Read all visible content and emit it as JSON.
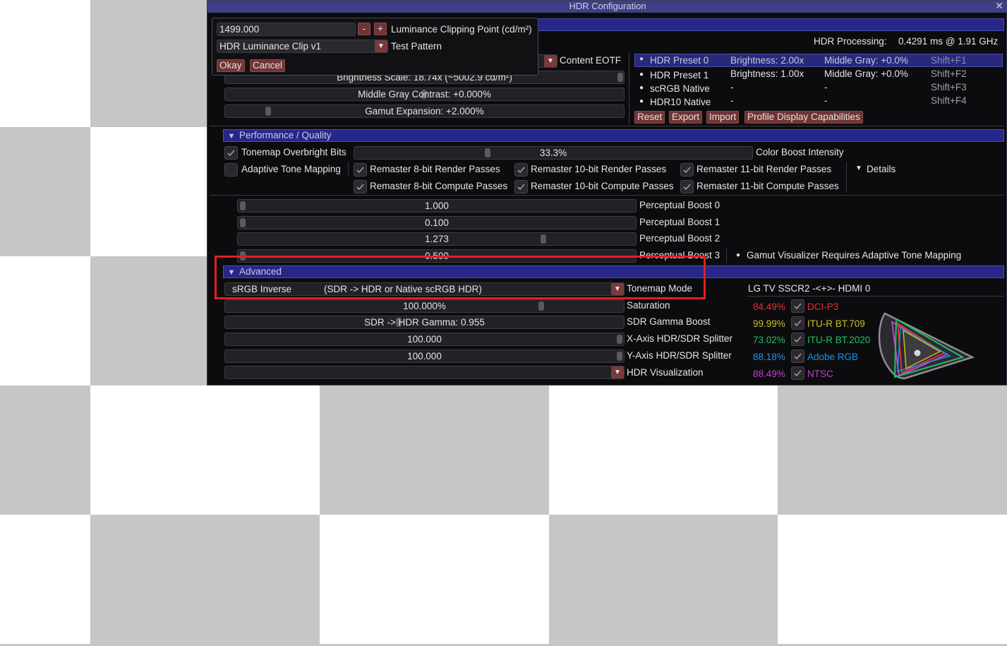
{
  "window": {
    "title": "HDR Configuration"
  },
  "popup": {
    "value": "1499.000",
    "minus": "-",
    "plus": "+",
    "clip_label": "Luminance Clipping Point (cd/m²)",
    "pattern_value": "HDR Luminance Clip v1",
    "pattern_label": "Test Pattern",
    "okay": "Okay",
    "cancel": "Cancel"
  },
  "status": {
    "processing_label": "HDR Processing:",
    "processing_value": "0.4291 ms @ 1.91 GHz"
  },
  "top": {
    "content_eotf_label": "Content EOTF",
    "brightness_scale": "Brightness Scale: 18.74x  (~5002.9 cd/m²)",
    "middle_gray_contrast": "Middle Gray Contrast: +0.000%",
    "gamut_expansion": "Gamut Expansion: +2.000%"
  },
  "presets": [
    {
      "name": "HDR Preset 0",
      "brightness": "Brightness: 2.00x",
      "middle_gray": "Middle Gray:  +0.0%",
      "hotkey": "Shift+F1",
      "selected": true
    },
    {
      "name": "HDR Preset 1",
      "brightness": "Brightness: 1.00x",
      "middle_gray": "Middle Gray:  +0.0%",
      "hotkey": "Shift+F2",
      "selected": false
    },
    {
      "name": "scRGB Native",
      "brightness": "-",
      "middle_gray": "-",
      "hotkey": "Shift+F3",
      "selected": false
    },
    {
      "name": "HDR10 Native",
      "brightness": "-",
      "middle_gray": "-",
      "hotkey": "Shift+F4",
      "selected": false
    }
  ],
  "preset_buttons": {
    "reset": "Reset",
    "export": "Export",
    "import": "Import",
    "profile": "Profile Display Capabilities"
  },
  "performance": {
    "header": "Performance / Quality",
    "tonemap_overbright": "Tonemap Overbright Bits",
    "color_boost_value": "33.3%",
    "color_boost_label": "Color Boost Intensity",
    "color_boost_level": 0.333,
    "adaptive_tone": "Adaptive Tone Mapping",
    "remaster_8_render": "Remaster 8-bit Render Passes",
    "remaster_10_render": "Remaster 10-bit Render Passes",
    "remaster_11_render": "Remaster 11-bit Render Passes",
    "remaster_8_compute": "Remaster 8-bit Compute Passes",
    "remaster_10_compute": "Remaster 10-bit Compute Passes",
    "remaster_11_compute": "Remaster 11-bit Compute Passes",
    "details": "Details"
  },
  "perceptual": [
    {
      "value": "1.000",
      "label": "Perceptual Boost 0"
    },
    {
      "value": "0.100",
      "label": "Perceptual Boost 1"
    },
    {
      "value": "1.273",
      "label": "Perceptual Boost 2"
    },
    {
      "value": "0.500",
      "label": "Perceptual Boost 3"
    }
  ],
  "gamut_note": "Gamut Visualizer Requires Adaptive Tone Mapping",
  "advanced": {
    "header": "Advanced",
    "tonemap_value_a": "sRGB Inverse",
    "tonemap_value_b": "(SDR -> HDR or Native scRGB HDR)",
    "tonemap_label": "Tonemap Mode",
    "saturation_value": "100.000%",
    "saturation_label": "Saturation",
    "sdr_gamma_value": "SDR -> HDR Gamma: 0.955",
    "sdr_gamma_label": "SDR Gamma Boost",
    "x_split_value": "100.000",
    "x_split_label": "X-Axis HDR/SDR Splitter",
    "y_split_value": "100.000",
    "y_split_label": "Y-Axis HDR/SDR Splitter",
    "hdr_vis_label": "HDR Visualization"
  },
  "display": {
    "name": "LG TV SSCR2 -<+>- HDMI 0",
    "gamuts": [
      {
        "pct": "84.49%",
        "name": "DCI-P3",
        "color": "#e03030"
      },
      {
        "pct": "99.99%",
        "name": "ITU-R BT.709",
        "color": "#c8c020"
      },
      {
        "pct": "73.02%",
        "name": "ITU-R BT.2020",
        "color": "#20c060"
      },
      {
        "pct": "88.18%",
        "name": "Adobe RGB",
        "color": "#2090e8"
      },
      {
        "pct": "88.49%",
        "name": "NTSC",
        "color": "#c040d0"
      }
    ]
  }
}
